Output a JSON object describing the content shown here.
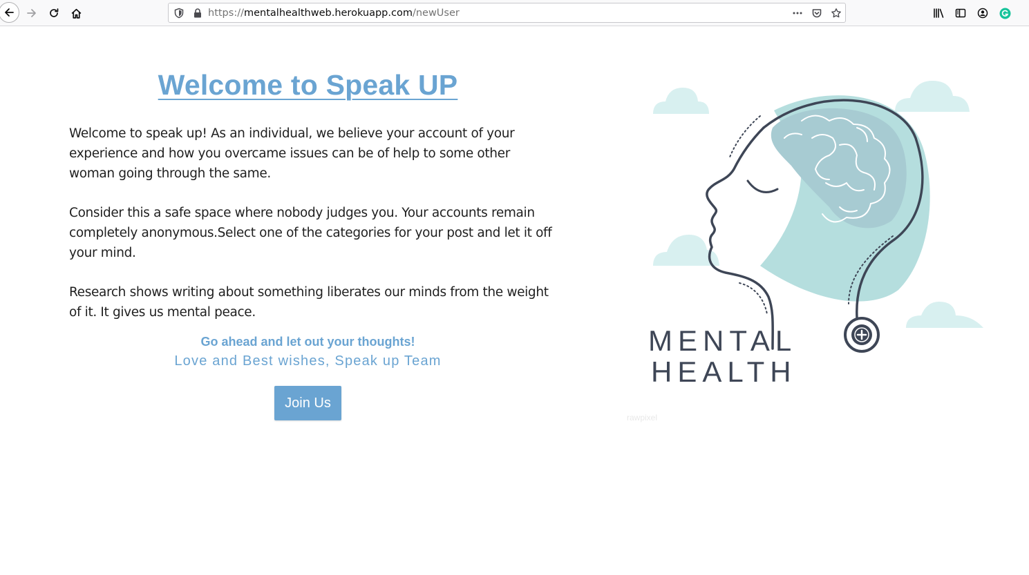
{
  "browser": {
    "url": {
      "protocol": "https://",
      "domain": "mentalhealthweb.herokuapp.com",
      "path": "/newUser"
    },
    "icons": [
      "back-arrow-icon",
      "forward-arrow-icon",
      "reload-icon",
      "home-icon",
      "shield-icon",
      "lock-icon",
      "more-actions-icon",
      "pocket-icon",
      "bookmark-star-icon",
      "library-icon",
      "sidebar-icon",
      "account-icon",
      "grammarly-icon"
    ]
  },
  "main": {
    "title": "Welcome to Speak UP",
    "paragraphs": [
      "Welcome to speak up! As an individual, we believe your account of your experience and how you overcame issues can be of help to some other woman going through the same.",
      "Consider this a safe space where nobody judges you. Your accounts remain completely anonymous.Select one of the categories for your post and let it off your mind.",
      "Research shows writing about something liberates our minds from the weight of it. It gives us mental peace."
    ],
    "cta": "Go ahead and let out your thoughts!",
    "signoff": "Love and Best wishes, Speak up Team",
    "join_button": "Join Us"
  },
  "illustration": {
    "line1": "MENTAL",
    "line2": "HEALTH",
    "watermark": "rawpixel"
  },
  "colors": {
    "accent": "#6aa4d2",
    "teal": "#b5dede",
    "cloud": "#d8f0f0",
    "outline": "#3e4656"
  }
}
